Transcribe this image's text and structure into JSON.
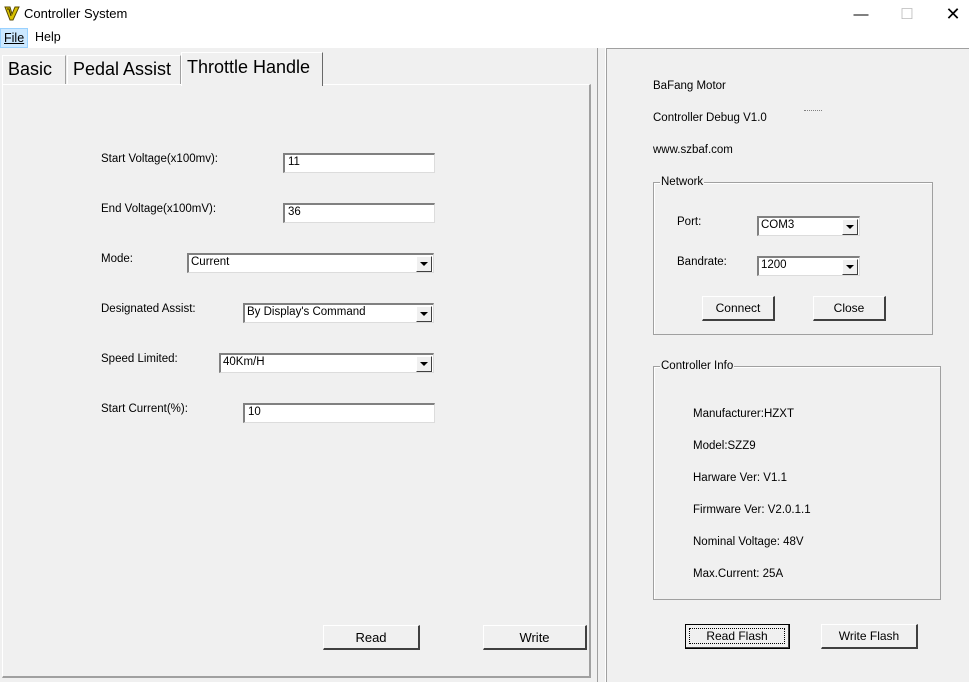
{
  "window": {
    "title": "Controller System",
    "minimize": "—",
    "maximize": "☐",
    "close": "✕"
  },
  "menu": {
    "file": "File",
    "help": "Help"
  },
  "tabs": {
    "basic": "Basic",
    "pedal_assist": "Pedal Assist",
    "throttle_handle": "Throttle Handle"
  },
  "throttle": {
    "start_voltage_label": "Start Voltage(x100mv):",
    "start_voltage_value": "11",
    "end_voltage_label": "End Voltage(x100mV):",
    "end_voltage_value": "36",
    "mode_label": "Mode:",
    "mode_value": "Current",
    "designated_assist_label": "Designated Assist:",
    "designated_assist_value": "By Display's Command",
    "speed_limited_label": "Speed Limited:",
    "speed_limited_value": "40Km/H",
    "start_current_label": "Start Current(%):",
    "start_current_value": "10",
    "read_button": "Read",
    "write_button": "Write"
  },
  "info": {
    "brand": "BaFang Motor",
    "app": "Controller Debug V1.0",
    "website": "www.szbaf.com"
  },
  "network": {
    "title": "Network",
    "port_label": "Port:",
    "port_value": "COM3",
    "bandrate_label": "Bandrate:",
    "bandrate_value": "1200",
    "connect_button": "Connect",
    "close_button": "Close"
  },
  "controller_info": {
    "title": "Controller Info",
    "manufacturer": "Manufacturer:HZXT",
    "model": "Model:SZZ9",
    "hardware": "Harware Ver: V1.1",
    "firmware": "Firmware Ver: V2.0.1.1",
    "nominal_voltage": "Nominal Voltage: 48V",
    "max_current": "Max.Current: 25A"
  },
  "flash": {
    "read_button": "Read Flash",
    "write_button": "Write Flash"
  },
  "colors": {
    "background": "#f0f0f0",
    "menu_highlight": "#cce8ff"
  }
}
